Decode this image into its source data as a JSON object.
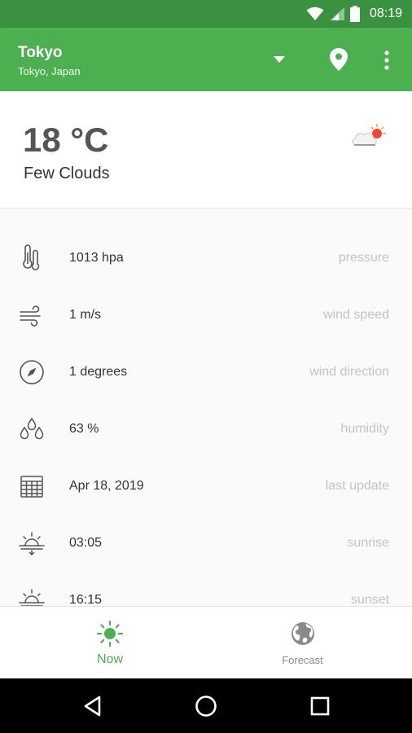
{
  "status_bar": {
    "time": "08:19"
  },
  "app_bar": {
    "title": "Tokyo",
    "subtitle": "Tokyo, Japan"
  },
  "current": {
    "temperature": "18 °C",
    "condition": "Few Clouds",
    "icon": "cloud-sun-icon"
  },
  "details": [
    {
      "value": "1013 hpa",
      "label": "pressure",
      "icon": "thermometer-icon"
    },
    {
      "value": "1 m/s",
      "label": "wind speed",
      "icon": "wind-icon"
    },
    {
      "value": "1 degrees",
      "label": "wind direction",
      "icon": "compass-icon"
    },
    {
      "value": "63 %",
      "label": "humidity",
      "icon": "humidity-drops-icon"
    },
    {
      "value": "Apr 18, 2019",
      "label": "last update",
      "icon": "calendar-icon"
    },
    {
      "value": "03:05",
      "label": "sunrise",
      "icon": "sunrise-icon"
    },
    {
      "value": "16:15",
      "label": "sunset",
      "icon": "sunset-icon"
    }
  ],
  "bottom_nav": {
    "now_label": "Now",
    "forecast_label": "Forecast"
  },
  "colors": {
    "primary": "#4caf50",
    "primary_dark": "#3a9140",
    "label_gray": "#c4c4c4"
  }
}
